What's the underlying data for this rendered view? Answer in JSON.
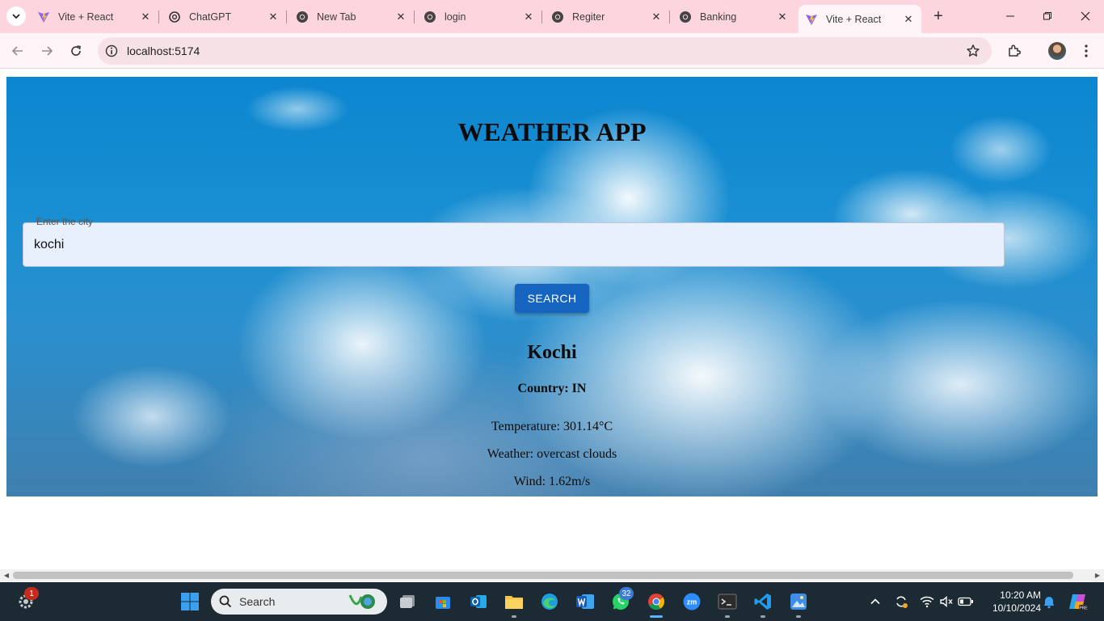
{
  "browser": {
    "tabs": [
      {
        "title": "Vite + React",
        "favicon": "vite-icon",
        "active": false
      },
      {
        "title": "ChatGPT",
        "favicon": "chatgpt-icon",
        "active": false
      },
      {
        "title": "New Tab",
        "favicon": "chrome-icon",
        "active": false
      },
      {
        "title": "login",
        "favicon": "globe-icon",
        "active": false
      },
      {
        "title": "Regiter",
        "favicon": "globe-icon",
        "active": false
      },
      {
        "title": "Banking",
        "favicon": "globe-icon",
        "active": false
      },
      {
        "title": "Vite + React",
        "favicon": "vite-icon",
        "active": true
      }
    ],
    "close_glyph": "✕",
    "new_tab_glyph": "+",
    "url": "localhost:5174",
    "colors": {
      "tabstrip": "#fcd5de",
      "toolbar": "#fff4f7",
      "omnibox": "#f6e1e7"
    }
  },
  "app": {
    "title": "WEATHER APP",
    "input_label": "Enter the city",
    "city_value": "kochi",
    "search_label": "SEARCH",
    "result": {
      "city": "Kochi",
      "country": "Country: IN",
      "temperature": "Temperature: 301.14°C",
      "weather": "Weather: overcast clouds",
      "wind": "Wind: 1.62m/s"
    },
    "colors": {
      "button": "#1565c0",
      "input_bg": "#e8f0fe"
    }
  },
  "taskbar": {
    "search_placeholder": "Search",
    "notification_badge": "1",
    "whatsapp_badge": "32",
    "time": "10:20 AM",
    "date": "10/10/2024",
    "apps": [
      "windows-start-icon",
      "search-icon",
      "task-view-icon",
      "microsoft-store-icon",
      "outlook-icon",
      "file-explorer-icon",
      "edge-icon",
      "word-icon",
      "whatsapp-icon",
      "chrome-icon",
      "zoom-icon",
      "terminal-icon",
      "vscode-icon",
      "paint-icon"
    ],
    "tray": [
      "chevron-up-icon",
      "sync-icon",
      "wifi-icon",
      "volume-muted-icon",
      "battery-icon",
      "notification-bell-icon",
      "copilot-icon"
    ]
  }
}
